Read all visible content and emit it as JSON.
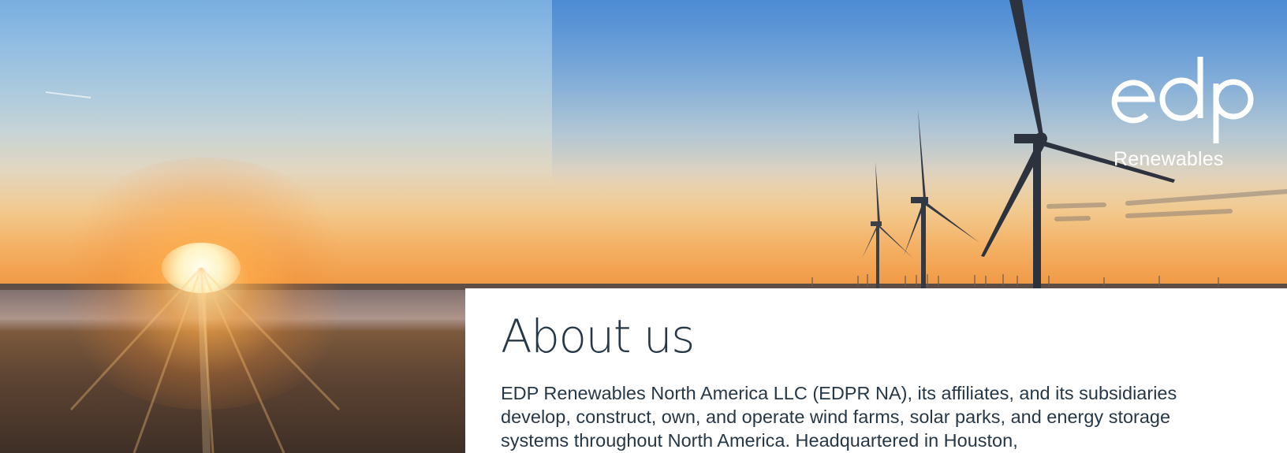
{
  "brand": {
    "logo_word": "edp",
    "logo_sub": "Renewables"
  },
  "hero": {
    "image": "sunrise-over-wind-farm",
    "colors": {
      "sky_top": "#78aee0",
      "horizon": "#f09a45",
      "text": "#263746"
    }
  },
  "about": {
    "title": "About us",
    "body": "EDP Renewables North America LLC (EDPR NA), its affiliates, and its subsidiaries develop, construct, own, and operate wind farms, solar parks, and energy storage systems throughout North America. Headquartered in Houston,"
  }
}
